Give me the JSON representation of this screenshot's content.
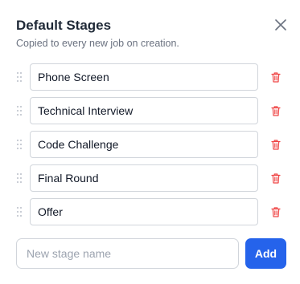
{
  "header": {
    "title": "Default Stages",
    "subtitle": "Copied to every new job on creation.",
    "close_icon": "close-icon"
  },
  "stages": [
    {
      "name": "Phone Screen"
    },
    {
      "name": "Technical Interview"
    },
    {
      "name": "Code Challenge"
    },
    {
      "name": "Final Round"
    },
    {
      "name": "Offer"
    }
  ],
  "icons": {
    "drag": "drag-handle-icon",
    "delete": "trash-icon"
  },
  "new_stage": {
    "value": "",
    "placeholder": "New stage name",
    "add_label": "Add"
  },
  "colors": {
    "accent": "#2563eb",
    "delete": "#ef4444",
    "handle": "#c4c9d1",
    "text": "#1f2937",
    "muted": "#6b7280"
  }
}
